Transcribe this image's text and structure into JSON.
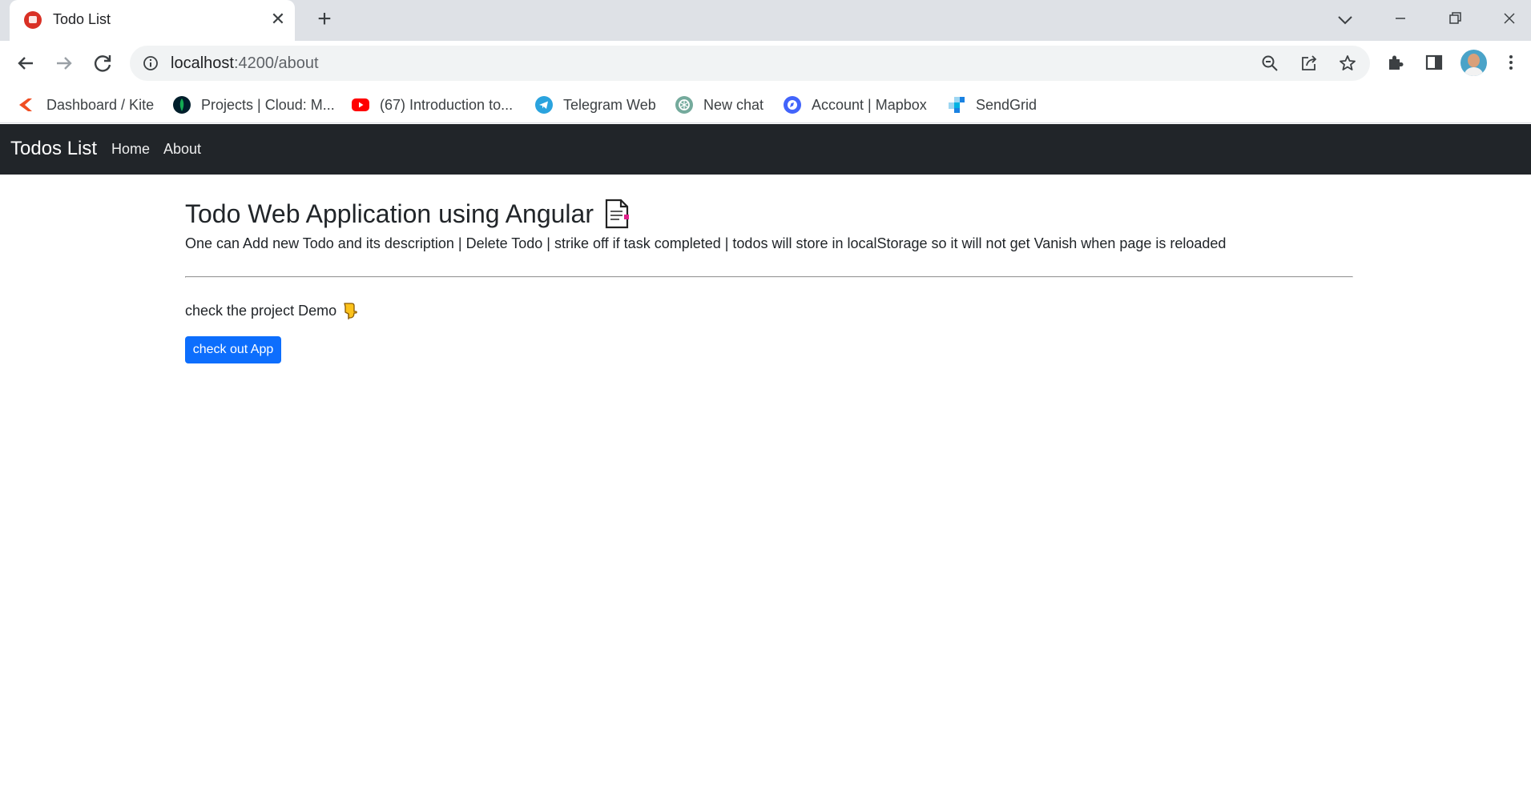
{
  "browser": {
    "tab": {
      "title": "Todo List",
      "close_glyph": "✕",
      "favicon": "todo-favicon"
    },
    "new_tab_glyph": "+",
    "address": {
      "host": "localhost",
      "path": ":4200/about"
    },
    "bookmarks": [
      {
        "label": "Dashboard / Kite",
        "icon": "kite-icon",
        "color": "#f04e23"
      },
      {
        "label": "Projects | Cloud: M...",
        "icon": "mongodb-icon",
        "color": "#13aa52"
      },
      {
        "label": "(67) Introduction to...",
        "icon": "youtube-icon",
        "color": "#ff0000"
      },
      {
        "label": "Telegram Web",
        "icon": "telegram-icon",
        "color": "#2aa3de"
      },
      {
        "label": "New chat",
        "icon": "openai-icon",
        "color": "#74aa9c"
      },
      {
        "label": "Account | Mapbox",
        "icon": "mapbox-icon",
        "color": "#4264fb"
      },
      {
        "label": "SendGrid",
        "icon": "sendgrid-icon",
        "color": "#1a82e2"
      }
    ]
  },
  "navbar": {
    "brand": "Todos List",
    "links": [
      "Home",
      "About"
    ],
    "background": "#212529"
  },
  "main": {
    "title": "Todo Web Application using Angular",
    "description": "One can Add new Todo and its description | Delete Todo | strike off if task completed | todos will store in localStorage so it will not get Vanish when page is reloaded",
    "demo_text": "check the project Demo",
    "button_label": "check out App",
    "button_color": "#0d6efd"
  }
}
